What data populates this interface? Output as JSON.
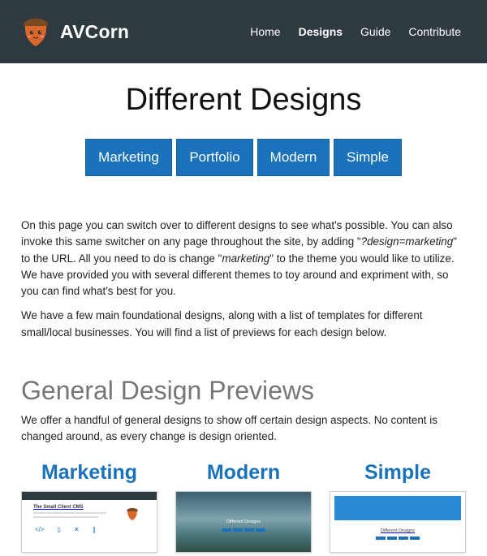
{
  "nav": {
    "brand": "AVCorn",
    "items": [
      "Home",
      "Designs",
      "Guide",
      "Contribute"
    ],
    "active": "Designs"
  },
  "page": {
    "title": "Different Designs",
    "design_buttons": [
      "Marketing",
      "Portfolio",
      "Modern",
      "Simple"
    ]
  },
  "intro": {
    "p1_a": "On this page you can switch over to different designs to see what's possible. You can also invoke this same switcher on any page throughout the site, by adding \"",
    "p1_code": "?design=marketing",
    "p1_b": "\" to the URL. All you need to do is change \"",
    "p1_code2": "marketing",
    "p1_c": "\" to the theme you would like to utilize. We have provided you with several different themes to toy around and expriment with, so you can find what's best for you.",
    "p2": "We have a few main foundational designs, along with a list of templates for different small/local businesses. You will find a list of previews for each design below."
  },
  "general": {
    "title": "General Design Previews",
    "text": "We offer a handful of general designs to show off certain design aspects. No content is changed around, as every change is design oriented.",
    "previews": [
      {
        "name": "Marketing",
        "thumb_heading": "The Small Client CMS"
      },
      {
        "name": "Modern",
        "thumb_heading": "Different Designs"
      },
      {
        "name": "Simple",
        "thumb_heading": "Different Designs"
      }
    ]
  },
  "colors": {
    "navbar": "#2f3940",
    "accent": "#1a72bb",
    "section_title": "#767676"
  },
  "icons": {
    "logo": "acorn-icon"
  }
}
